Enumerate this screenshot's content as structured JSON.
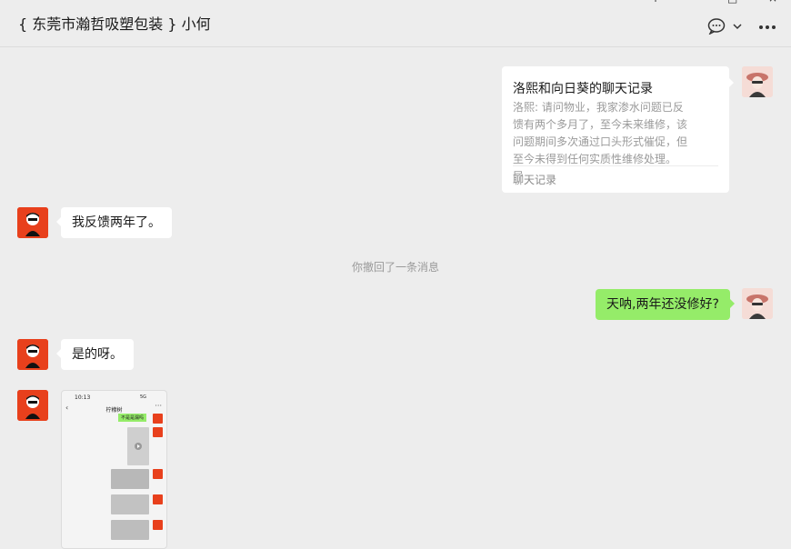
{
  "header": {
    "title": "{ 东莞市瀚哲吸塑包装 } 小何",
    "window_controls": [
      "+",
      "□",
      "×"
    ],
    "chat_icon": "chat-bubble-icon",
    "dropdown_icon": "chevron-down-icon",
    "more_icon": "more-icon"
  },
  "messages": {
    "card": {
      "title": "洛熙和向日葵的聊天记录",
      "preview": "洛熙: 请问物业，我家渗水问题已反馈有两个多月了，至今未来维修，该问题期间多次通过口头形式催促，但至今未得到任何实质性维修处理。导...",
      "footer": "聊天记录"
    },
    "msg1": "我反馈两年了。",
    "recall_notice": "你撤回了一条消息",
    "msg2": "天呐,两年还没修好?",
    "msg3": "是的呀。",
    "shot": {
      "time": "10:13",
      "status": "5G",
      "title": "柠檬树",
      "green": "不是是漏吗"
    }
  },
  "colors": {
    "background": "#ededed",
    "bubble_self": "#95ec69",
    "bubble_other": "#ffffff",
    "avatar_red": "#e8401c"
  }
}
